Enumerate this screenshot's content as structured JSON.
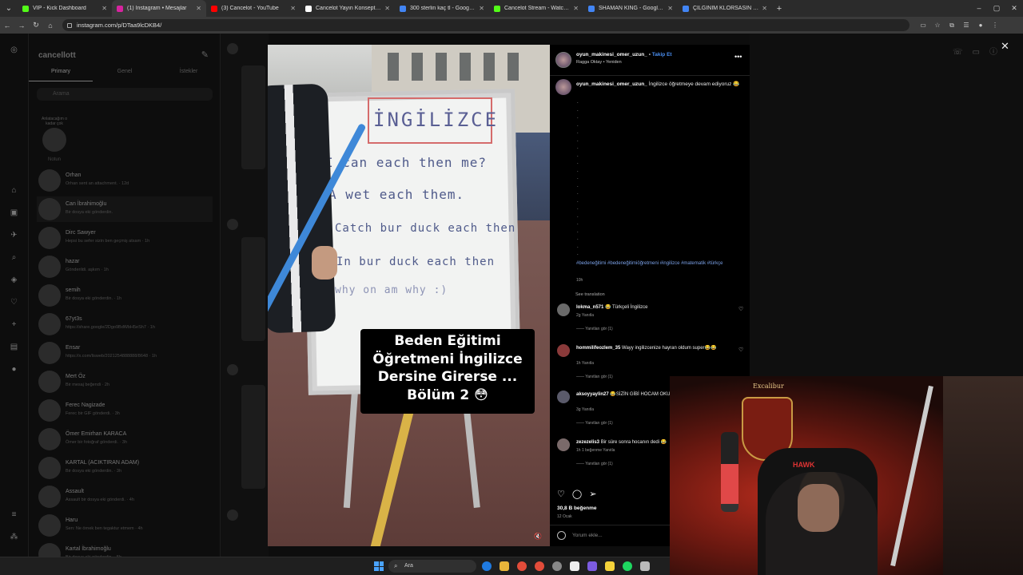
{
  "browser": {
    "tabs": [
      {
        "title": "VIP - Kick Dashboard",
        "color": "#53fc18"
      },
      {
        "title": "(1) Instagram • Mesajlar",
        "color": "#d6249f",
        "active": true
      },
      {
        "title": "(3) Cancelot - YouTube",
        "color": "#ff0000"
      },
      {
        "title": "Cancelot Yayın Konseptleri",
        "color": "#ffffff"
      },
      {
        "title": "300 sterlin kaç tl - Google'da Ara",
        "color": "#4285f4"
      },
      {
        "title": "Cancelot Stream - Watch Live on",
        "color": "#53fc18"
      },
      {
        "title": "SHAMAN KING - Google'da Ara",
        "color": "#4285f4"
      },
      {
        "title": "ÇILGINIM KLORSASIN JACK - Go",
        "color": "#4285f4"
      }
    ],
    "url": "instagram.com/p/DTaa9lcDKB4/",
    "newtab_label": "+"
  },
  "inbox": {
    "username": "cancellott",
    "tabs": [
      "Primary",
      "Genel",
      "İstekler"
    ],
    "search_placeholder": "Arama",
    "note_bubble": "Anlatacağım o kadar çok",
    "note_label": "Notun",
    "conversations": [
      {
        "name": "Orhan",
        "msg": "Orhan sent an attachment. · 12d"
      },
      {
        "name": "Can İbrahimoğlu",
        "msg": "Bir dosya eki gönderdin."
      },
      {
        "name": "Dirc Sawyer",
        "msg": "Hepsi bu sefer sizin ben geçmiş atsam · 1h"
      },
      {
        "name": "hazar",
        "msg": "Gönderildi. aşkım · 1h"
      },
      {
        "name": "semih",
        "msg": "Bir dosya eki gönderdin. · 1h"
      },
      {
        "name": "67yt3s",
        "msg": "https://share.google/2Dgo9BdWbH5eSh7 · 1h"
      },
      {
        "name": "Ensar",
        "msg": "https://x.com/lisweb/2021254888888/8648 · 1h"
      },
      {
        "name": "Mert Öz",
        "msg": "Bir mesaj beğendi · 2h"
      },
      {
        "name": "Ferec Nagizade",
        "msg": "Ferec bir GIF gönderdi. · 3h"
      },
      {
        "name": "Ömer Emirhan KARACA",
        "msg": "Ömer bir fotoğraf gönderdi. · 3h"
      },
      {
        "name": "KARTAL (ACIKTIRAN ADAM)",
        "msg": "Bir dosya eki gönderdin. · 3h"
      },
      {
        "name": "Assault",
        "msg": "Assault bir dosya eki gönderdi. · 4h"
      },
      {
        "name": "Haru",
        "msg": "Sen: Ne örnek ben tegaktur etmem · 4h"
      },
      {
        "name": "Kartal İbrahimoğlu",
        "msg": "Bir dosya eki gönderdin. · 5h"
      }
    ]
  },
  "video": {
    "board_title": "İNGİLİZCE",
    "board_lines": [
      "I can each then me?",
      "A wet each them.",
      "Catch bur duck each then",
      "In bur duck each then",
      "why on am why :)"
    ],
    "caption": "Beden Eğitimi Öğretmeni İngilizce Dersine Girerse ... Bölüm 2 😳",
    "mute_icon": "speaker-muted"
  },
  "post": {
    "author": "oyun_makinesi_omer_uzun_",
    "follow": "Takip Et",
    "subline": "Ragga Oktay • Yeniden",
    "caption_user": "oyun_makinesi_omer_uzun_",
    "caption": "İngilizce öğretmeye devam ediyoruz 😂",
    "hashtags": "#bedeneğitimi #bedeneğitimiöğretmeni #ingilizce #matematik #türkçe",
    "time": "10h",
    "see_translation": "See translation",
    "comments": [
      {
        "user": "lokma_n571",
        "text": "😂 Türkçeli İngilizce",
        "meta": "2g   Yanıtla",
        "replies": "——  Yanıtları gör (1)"
      },
      {
        "user": "hommilifeozlem_35",
        "text": "Wayy ingilizcenize hayran oldum super😂😂",
        "meta": "1h   Yanıtla",
        "replies": "——  Yanıtları gör (1)"
      },
      {
        "user": "aksoyyaylin27",
        "text": "😂SİZİN GİBİ HOCAM OKUMADIM HOCAM",
        "meta": "3g   Yanıtla",
        "replies": "——  Yanıtları gör (1)"
      },
      {
        "user": "zezezelis3",
        "text": "Bir süre sonra hocanın dedi 😂",
        "meta": "1h   1 beğenme   Yanıtla",
        "replies": "——  Yanıtları gör (1)"
      }
    ],
    "likes": "30,8 B beğenme",
    "date": "12 Ocak",
    "add_comment_placeholder": "Yorum ekle..."
  },
  "webcam": {
    "sign": "Excalibur",
    "chair_brand": "HAWK"
  },
  "taskbar": {
    "search_label": "Ara"
  }
}
